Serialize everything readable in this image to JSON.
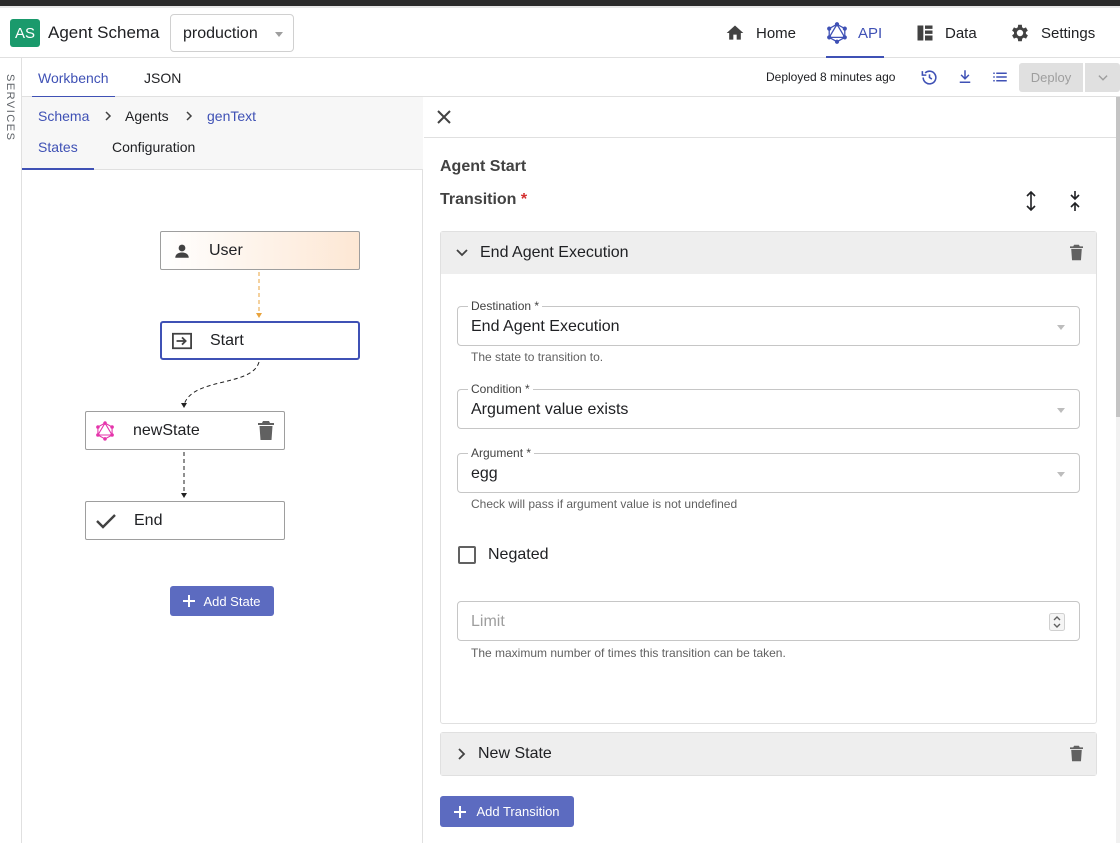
{
  "app": {
    "logo_text": "AS",
    "title": "Agent Schema",
    "environment": "production"
  },
  "nav": {
    "home": "Home",
    "api": "API",
    "data": "Data",
    "settings": "Settings"
  },
  "rail": {
    "label": "SERVICES"
  },
  "subtabs": {
    "workbench": "Workbench",
    "json": "JSON"
  },
  "toolbar": {
    "deployed_text": "Deployed 8 minutes ago",
    "deploy_label": "Deploy"
  },
  "breadcrumb": {
    "schema": "Schema",
    "agents": "Agents",
    "current": "genText"
  },
  "panel_tabs": {
    "states": "States",
    "configuration": "Configuration"
  },
  "graph": {
    "nodes": {
      "user": "User",
      "start": "Start",
      "new_state": "newState",
      "end": "End"
    },
    "add_state": "Add State"
  },
  "detail": {
    "title": "Agent Start",
    "transition_label": "Transition",
    "required_mark": "*",
    "transitions": [
      {
        "title": "End Agent Execution",
        "destination": {
          "label": "Destination *",
          "value": "End Agent Execution",
          "help": "The state to transition to."
        },
        "condition": {
          "label": "Condition *",
          "value": "Argument value exists"
        },
        "argument": {
          "label": "Argument *",
          "value": "egg",
          "help": "Check will pass if argument value is not undefined"
        },
        "negated_label": "Negated",
        "limit": {
          "placeholder": "Limit",
          "help": "The maximum number of times this transition can be taken."
        }
      },
      {
        "title": "New State"
      }
    ],
    "add_transition": "Add Transition"
  },
  "colors": {
    "accent": "#3f51b5",
    "button": "#5c6bc0",
    "logo": "#1a9a6c",
    "user_node": "#fde7d4",
    "edge_user": "#e8a33d"
  }
}
